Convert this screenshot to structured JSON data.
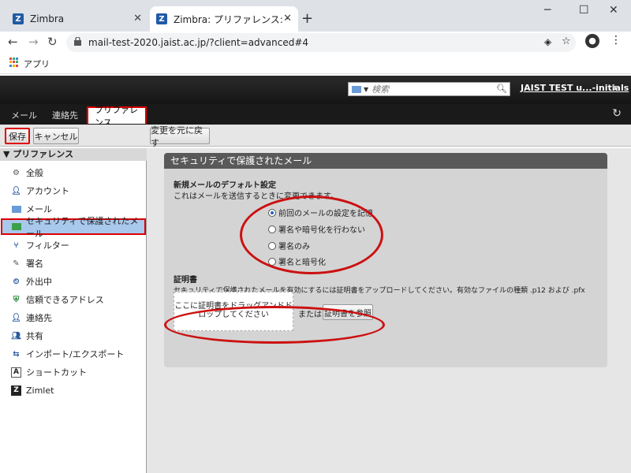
{
  "browser": {
    "tabs": [
      {
        "title": "Zimbra"
      },
      {
        "title": "Zimbra: プリファレンス: セキュリティで"
      }
    ],
    "url": "mail-test-2020.jaist.ac.jp/?client=advanced#4",
    "bookmarks_label": "アプリ"
  },
  "header": {
    "search_placeholder": "検索",
    "user": "JAIST TEST u...-initials"
  },
  "app_tabs": [
    "メール",
    "連絡先",
    "プリファレンス"
  ],
  "toolbar": {
    "save": "保存",
    "cancel": "キャンセル",
    "revert": "変更を元に戻す"
  },
  "sidebar": {
    "heading": "プリファレンス",
    "items": [
      {
        "label": "全般",
        "icon": "gear-icon"
      },
      {
        "label": "アカウント",
        "icon": "account-icon"
      },
      {
        "label": "メール",
        "icon": "mail-icon"
      },
      {
        "label": "セキュリティで保護されたメール",
        "icon": "secure-mail-icon"
      },
      {
        "label": "フィルター",
        "icon": "filter-icon"
      },
      {
        "label": "署名",
        "icon": "signature-icon"
      },
      {
        "label": "外出中",
        "icon": "out-of-office-icon"
      },
      {
        "label": "信頼できるアドレス",
        "icon": "shield-icon"
      },
      {
        "label": "連絡先",
        "icon": "contacts-icon"
      },
      {
        "label": "共有",
        "icon": "share-icon"
      },
      {
        "label": "インポート/エクスポート",
        "icon": "import-export-icon"
      },
      {
        "label": "ショートカット",
        "icon": "shortcut-icon"
      },
      {
        "label": "Zimlet",
        "icon": "zimlet-icon"
      }
    ]
  },
  "main": {
    "title": "セキュリティで保護されたメール",
    "default_heading": "新規メールのデフォルト設定",
    "default_desc": "これはメールを送信するときに変更できます。",
    "options": [
      {
        "label": "前回のメールの設定を記憶",
        "checked": true
      },
      {
        "label": "署名や暗号化を行わない",
        "checked": false
      },
      {
        "label": "署名のみ",
        "checked": false
      },
      {
        "label": "署名と暗号化",
        "checked": false
      }
    ],
    "cert_heading": "証明書",
    "cert_desc": "セキュリティで保護されたメールを有効にするには証明書をアップロードしてください。有効なファイルの種類 .p12 および .pfx",
    "drop_text": "ここに証明書をドラッグアンドドロップしてください",
    "or_text": "または",
    "browse_label": "証明書を参照"
  }
}
